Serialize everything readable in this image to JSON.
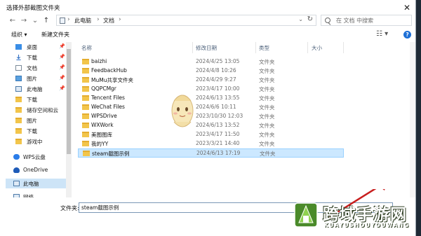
{
  "dialog": {
    "title": "选择外部截图文件夹",
    "close_glyph": "✕"
  },
  "address": {
    "back": "←",
    "forward": "→",
    "recent": "⌄",
    "up": "↑",
    "crumbs": [
      "此电脑",
      "文档"
    ],
    "separators": [
      "›",
      "›",
      "›"
    ],
    "dropdown": "⌄",
    "refresh": "↻",
    "search_placeholder": "在 文档 中搜索"
  },
  "toolbar": {
    "organize": "组织 ▾",
    "new_folder": "新建文件夹",
    "view": "☷ ▾",
    "help": "?"
  },
  "sidebar": {
    "pin_glyph": "📌",
    "items": [
      {
        "label": "桌面",
        "icon": "desktop-icon",
        "pinned": true
      },
      {
        "label": "下载",
        "icon": "download-icon",
        "pinned": true
      },
      {
        "label": "文档",
        "icon": "document-icon",
        "pinned": true
      },
      {
        "label": "图片",
        "icon": "pictures-icon",
        "pinned": true
      },
      {
        "label": "此电脑",
        "icon": "computer-icon",
        "pinned": true
      },
      {
        "label": "下载",
        "icon": "folder-icon",
        "pinned": false
      },
      {
        "label": "储存空间和云",
        "icon": "folder-icon",
        "pinned": false
      },
      {
        "label": "图片",
        "icon": "folder-icon",
        "pinned": false
      },
      {
        "label": "下载",
        "icon": "folder-icon",
        "pinned": false
      },
      {
        "label": "游戏中",
        "icon": "folder-icon",
        "pinned": false
      },
      {
        "label": "WPS云盘",
        "icon": "wps-cloud-icon",
        "pinned": false
      },
      {
        "label": "OneDrive",
        "icon": "onedrive-icon",
        "pinned": false
      },
      {
        "label": "此电脑",
        "icon": "computer-icon",
        "pinned": false,
        "selected": true
      },
      {
        "label": "网络",
        "icon": "network-icon",
        "pinned": false
      }
    ]
  },
  "columns": {
    "name": "名称",
    "date": "修改日期",
    "type": "类型",
    "size": "大小"
  },
  "files": [
    {
      "name": "baizhi",
      "date": "2024/4/25 13:05",
      "type": "文件夹"
    },
    {
      "name": "FeedbackHub",
      "date": "2024/4/8 10:26",
      "type": "文件夹"
    },
    {
      "name": "MuMu共享文件夹",
      "date": "2024/4/29 9:27",
      "type": "文件夹"
    },
    {
      "name": "QQPCMgr",
      "date": "2023/4/17 10:00",
      "type": "文件夹"
    },
    {
      "name": "Tencent Files",
      "date": "2024/6/13 13:55",
      "type": "文件夹"
    },
    {
      "name": "WeChat Files",
      "date": "2024/6/6 10:11",
      "type": "文件夹"
    },
    {
      "name": "WPSDrive",
      "date": "2023/10/30 12:03",
      "type": "文件夹"
    },
    {
      "name": "WXWork",
      "date": "2024/6/13 13:52",
      "type": "文件夹"
    },
    {
      "name": "美图图库",
      "date": "2023/4/17 11:50",
      "type": "文件夹"
    },
    {
      "name": "我的YY",
      "date": "2023/3/21 14:40",
      "type": "文件夹"
    },
    {
      "name": "steam截图示例",
      "date": "2024/6/13 17:19",
      "type": "文件夹",
      "selected": true
    }
  ],
  "filename": {
    "label": "文件夹:",
    "value": "steam截图示例"
  },
  "watermark": {
    "title": "跨域手游网",
    "subtitle": "KUAYUSHOUYOUWANG"
  },
  "colors": {
    "accent": "#1d6fd6",
    "selection": "#cce8ff",
    "folder": "#f2c54b"
  }
}
